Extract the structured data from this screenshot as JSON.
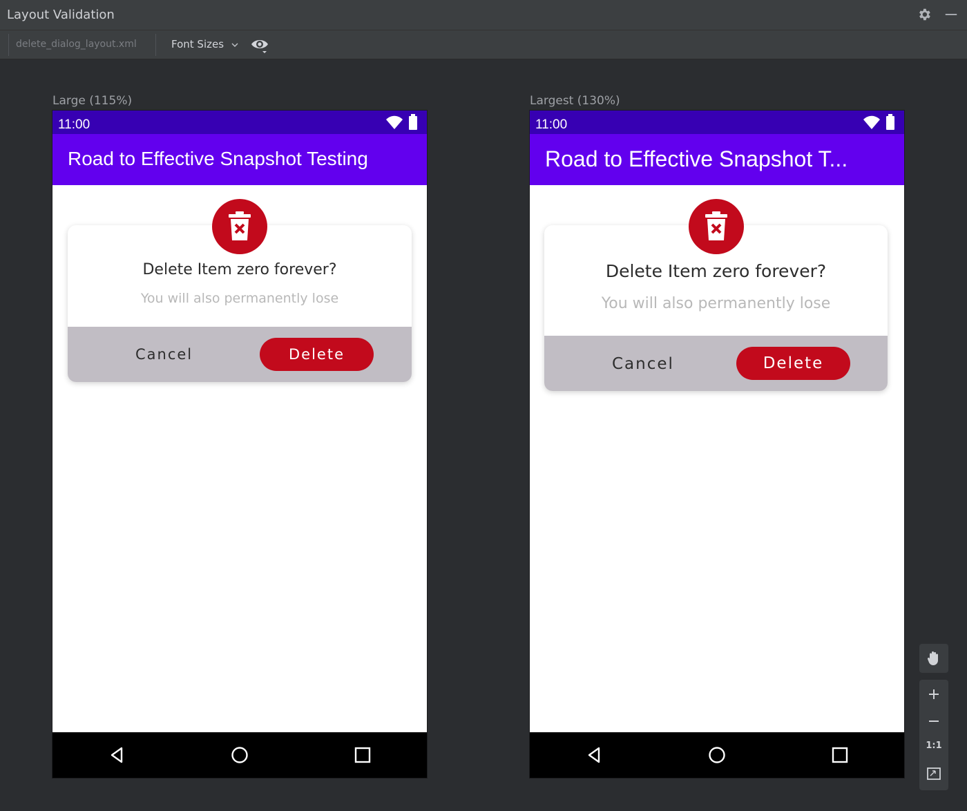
{
  "window": {
    "title": "Layout Validation"
  },
  "toolbar": {
    "file_name": "delete_dialog_layout.xml",
    "font_sizes_label": "Font Sizes"
  },
  "previews": [
    {
      "label": "Large (115%)",
      "time": "11:00",
      "app_title": "Road to Effective Snapshot Testing",
      "dialog": {
        "headline": "Delete Item zero forever?",
        "subtext": "You will also permanently lose",
        "cancel": "Cancel",
        "delete": "Delete"
      }
    },
    {
      "label": "Largest (130%)",
      "time": "11:00",
      "app_title": "Road to Effective Snapshot T...",
      "dialog": {
        "headline": "Delete Item zero forever?",
        "subtext": "You will also permanently lose",
        "cancel": "Cancel",
        "delete": "Delete"
      }
    }
  ],
  "side_tools": {
    "actual_size_label": "1:1"
  },
  "colors": {
    "status_bar": "#3700b3",
    "app_bar": "#6200ee",
    "danger": "#c20a1c",
    "dialog_actions_bg": "#c1bdc4",
    "ide_bg": "#2b2d30"
  },
  "icons": [
    "gear-icon",
    "minimize-icon",
    "chevron-down-icon",
    "eye-icon",
    "wifi-icon",
    "battery-icon",
    "trash-icon",
    "back-icon",
    "home-icon",
    "recents-icon",
    "hand-icon",
    "zoom-in-icon",
    "zoom-out-icon",
    "fit-screen-icon"
  ]
}
